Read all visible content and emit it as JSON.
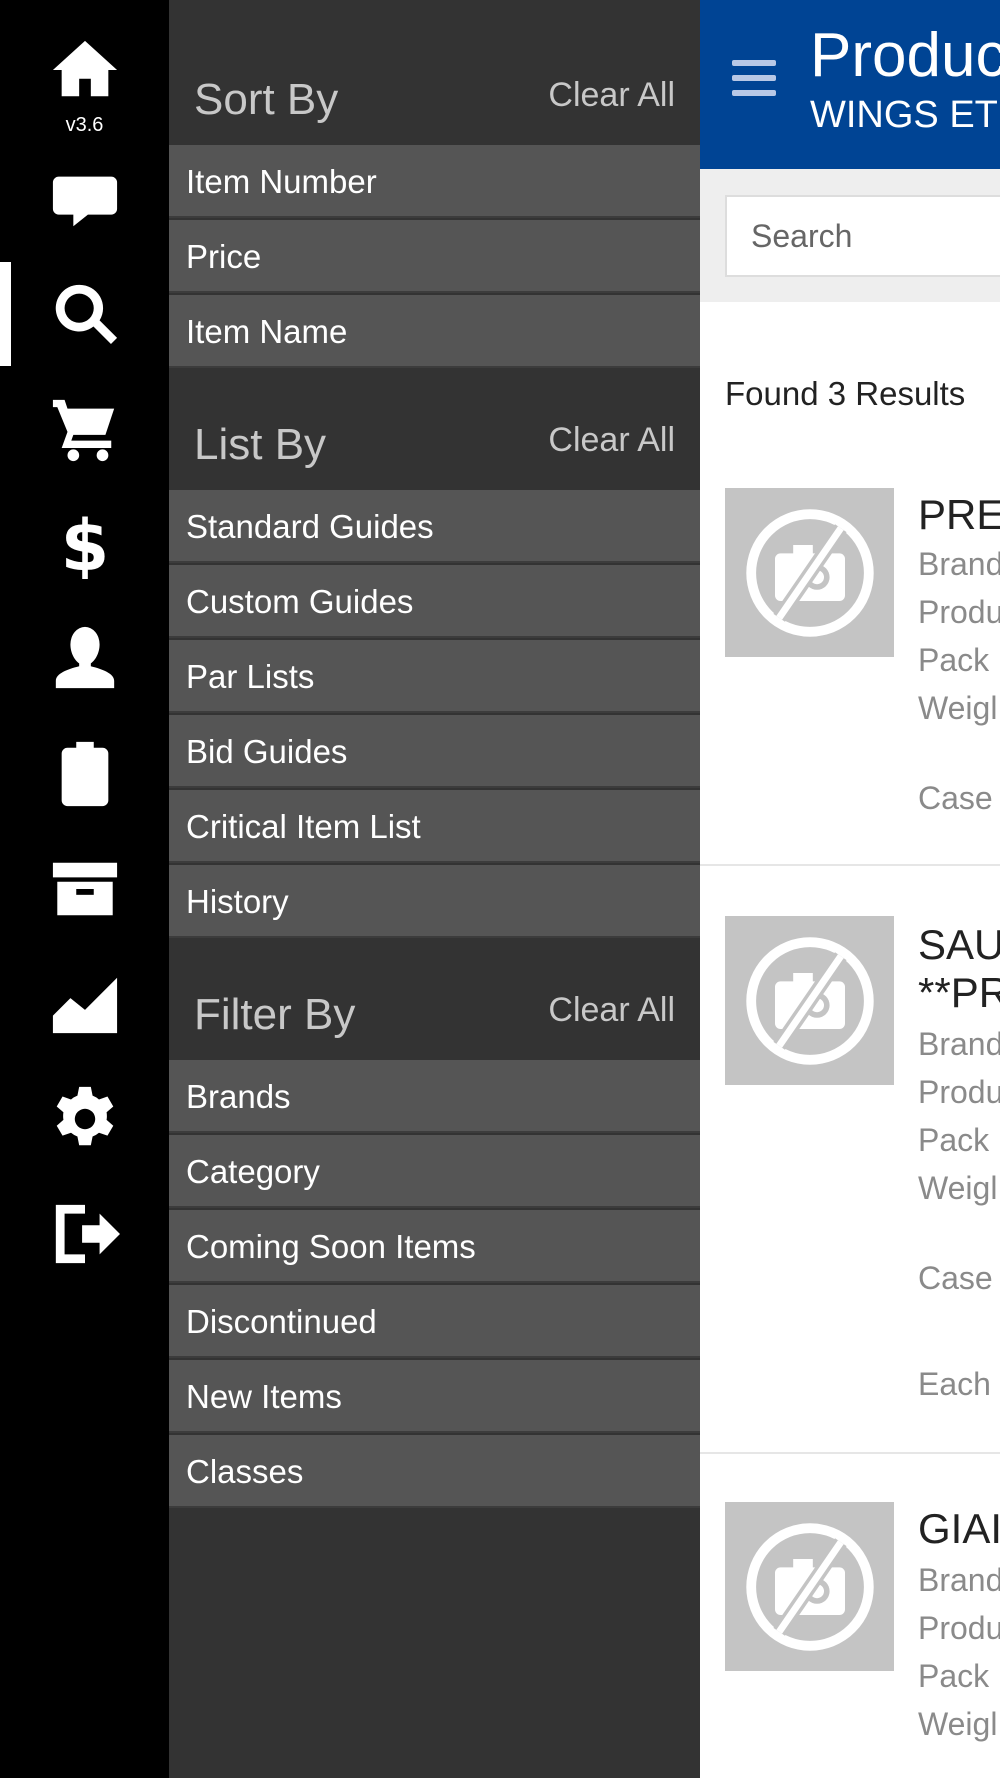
{
  "rail": {
    "version": "v3.6",
    "icons": [
      "home-icon",
      "chat-icon",
      "search-icon",
      "cart-icon",
      "dollar-icon",
      "user-icon",
      "clipboard-icon",
      "archive-icon",
      "chart-icon",
      "gear-icon",
      "logout-icon"
    ]
  },
  "panel": {
    "sort": {
      "title": "Sort By",
      "clear": "Clear All",
      "options": [
        "Item Number",
        "Price",
        "Item Name"
      ]
    },
    "list": {
      "title": "List By",
      "clear": "Clear All",
      "options": [
        "Standard Guides",
        "Custom Guides",
        "Par Lists",
        "Bid Guides",
        "Critical Item List",
        "History"
      ]
    },
    "filter": {
      "title": "Filter By",
      "clear": "Clear All",
      "options": [
        "Brands",
        "Category",
        "Coming Soon Items",
        "Discontinued",
        "New Items",
        "Classes"
      ]
    }
  },
  "main": {
    "title": "Produc",
    "subtitle": "WINGS ET",
    "search_placeholder": "Search",
    "result_count": "Found 3 Results",
    "products": [
      {
        "name": "PRET",
        "lines": [
          "Brand",
          "Produ",
          "Pack",
          "Weigl",
          "Case"
        ]
      },
      {
        "name": "SAU",
        "name2": "**PR",
        "lines": [
          "Brand",
          "Produ",
          "Pack",
          "Weigl",
          "Case",
          "Each"
        ]
      },
      {
        "name": "GIAI",
        "lines": [
          "Brand",
          "Produ",
          "Pack",
          "Weigl"
        ]
      }
    ]
  },
  "colors": {
    "rail_bg": "#000000",
    "panel_bg": "#333333",
    "option_bg": "#555555",
    "header_blue": "#004494",
    "placeholder_gray": "#c4c4c4"
  }
}
